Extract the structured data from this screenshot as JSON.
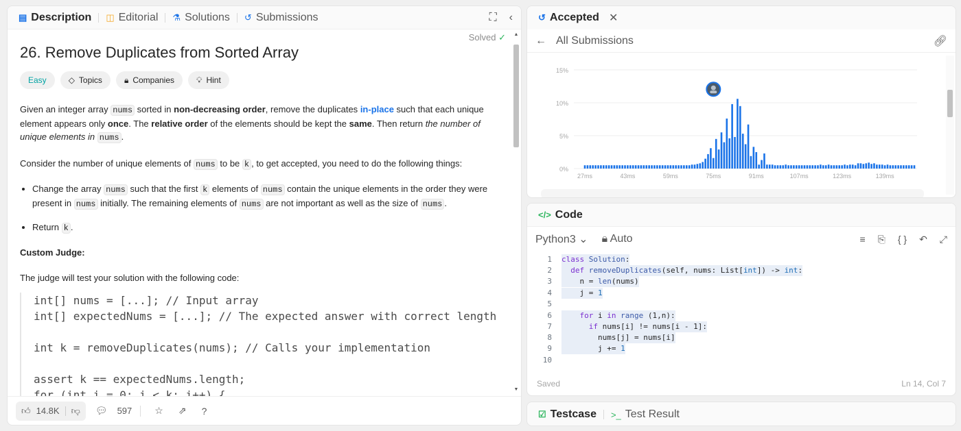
{
  "left_tabs": [
    {
      "label": "Description",
      "icon": "document-icon",
      "active": true
    },
    {
      "label": "Editorial",
      "icon": "book-icon",
      "active": false
    },
    {
      "label": "Solutions",
      "icon": "flask-icon",
      "active": false
    },
    {
      "label": "Submissions",
      "icon": "history-icon",
      "active": false
    }
  ],
  "problem": {
    "title": "26. Remove Duplicates from Sorted Array",
    "status": "Solved",
    "chips": [
      "Easy",
      "Topics",
      "Companies",
      "Hint"
    ],
    "custom_judge_heading": "Custom Judge:",
    "judge_intro": "The judge will test your solution with the following code:",
    "code_lines": [
      "int[] nums = [...]; // Input array",
      "int[] expectedNums = [...]; // The expected answer with correct length",
      "",
      "int k = removeDuplicates(nums); // Calls your implementation",
      "",
      "assert k == expectedNums.length;",
      "for (int i = 0; i < k; i++) {"
    ]
  },
  "footer": {
    "likes": "14.8K",
    "comments": "597"
  },
  "accepted": {
    "tab_label": "Accepted",
    "back_label": "All Submissions",
    "chart_data": {
      "type": "bar",
      "y_ticks": [
        "15%",
        "10%",
        "5%",
        "0%"
      ],
      "x_ticks": [
        "27ms",
        "43ms",
        "59ms",
        "75ms",
        "91ms",
        "107ms",
        "123ms",
        "139ms"
      ],
      "ylim": [
        0,
        15
      ],
      "x": [
        27,
        28,
        29,
        30,
        31,
        32,
        33,
        34,
        35,
        36,
        37,
        38,
        39,
        40,
        41,
        42,
        43,
        44,
        45,
        46,
        47,
        48,
        49,
        50,
        51,
        52,
        53,
        54,
        55,
        56,
        57,
        58,
        59,
        60,
        61,
        62,
        63,
        64,
        65,
        66,
        67,
        68,
        69,
        70,
        71,
        72,
        73,
        74,
        75,
        76,
        77,
        78,
        79,
        80,
        81,
        82,
        83,
        84,
        85,
        86,
        87,
        88,
        89,
        90,
        91,
        92,
        93,
        94,
        95,
        96,
        97,
        98,
        99,
        100,
        101,
        102,
        103,
        104,
        105,
        106,
        107,
        108,
        109,
        110,
        111,
        112,
        113,
        114,
        115,
        116,
        117,
        118,
        119,
        120,
        121,
        122,
        123,
        124,
        125,
        126,
        127,
        128,
        129,
        130,
        131,
        132,
        133,
        134,
        135,
        136,
        137,
        138,
        139,
        140,
        141,
        142,
        143,
        144,
        145,
        146,
        147,
        148,
        149,
        150
      ],
      "values": [
        0.5,
        0.5,
        0.5,
        0.5,
        0.5,
        0.5,
        0.5,
        0.5,
        0.5,
        0.5,
        0.5,
        0.5,
        0.5,
        0.5,
        0.5,
        0.5,
        0.5,
        0.5,
        0.5,
        0.5,
        0.5,
        0.5,
        0.5,
        0.5,
        0.5,
        0.5,
        0.5,
        0.5,
        0.5,
        0.5,
        0.5,
        0.5,
        0.5,
        0.5,
        0.5,
        0.5,
        0.5,
        0.5,
        0.5,
        0.5,
        0.6,
        0.6,
        0.7,
        0.8,
        1.0,
        1.5,
        2.2,
        3.1,
        1.6,
        4.5,
        2.9,
        5.5,
        4.0,
        7.6,
        4.6,
        9.8,
        4.8,
        10.6,
        9.5,
        5.3,
        3.7,
        6.7,
        1.9,
        3.3,
        2.5,
        0.6,
        1.3,
        2.3,
        0.6,
        0.6,
        0.6,
        0.5,
        0.5,
        0.5,
        0.5,
        0.6,
        0.5,
        0.5,
        0.5,
        0.5,
        0.5,
        0.5,
        0.5,
        0.5,
        0.5,
        0.5,
        0.5,
        0.5,
        0.6,
        0.5,
        0.5,
        0.6,
        0.5,
        0.5,
        0.5,
        0.5,
        0.5,
        0.6,
        0.5,
        0.6,
        0.6,
        0.5,
        0.8,
        0.8,
        0.7,
        0.8,
        0.9,
        0.7,
        0.8,
        0.6,
        0.6,
        0.6,
        0.5,
        0.6,
        0.5,
        0.5,
        0.5,
        0.5,
        0.5,
        0.5,
        0.5,
        0.5,
        0.5,
        0.5
      ],
      "marker_x": 75
    }
  },
  "code_panel": {
    "title": "Code",
    "language": "Python3",
    "mode": "Auto",
    "status_left": "Saved",
    "status_right": "Ln 14, Col 7"
  },
  "bottom_tabs": [
    {
      "label": "Testcase",
      "active": true
    },
    {
      "label": "Test Result",
      "active": false
    }
  ]
}
